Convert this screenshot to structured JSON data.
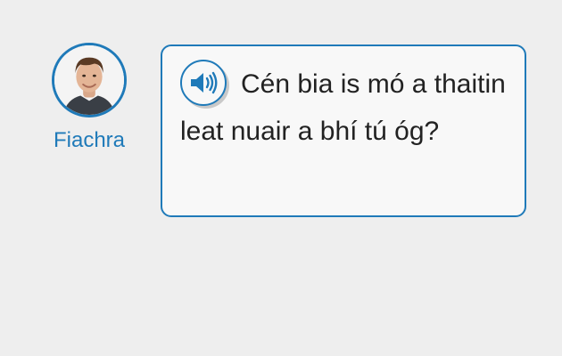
{
  "speaker": {
    "name": "Fiachra"
  },
  "message": {
    "text": "Cén bia is mó a thaitin leat nuair a bhí tú óg?",
    "audio_icon": "speaker-volume-icon"
  },
  "colors": {
    "accent": "#1f7ab9",
    "background": "#eeeeee",
    "bubble_background": "#f8f8f8",
    "text": "#222222"
  }
}
